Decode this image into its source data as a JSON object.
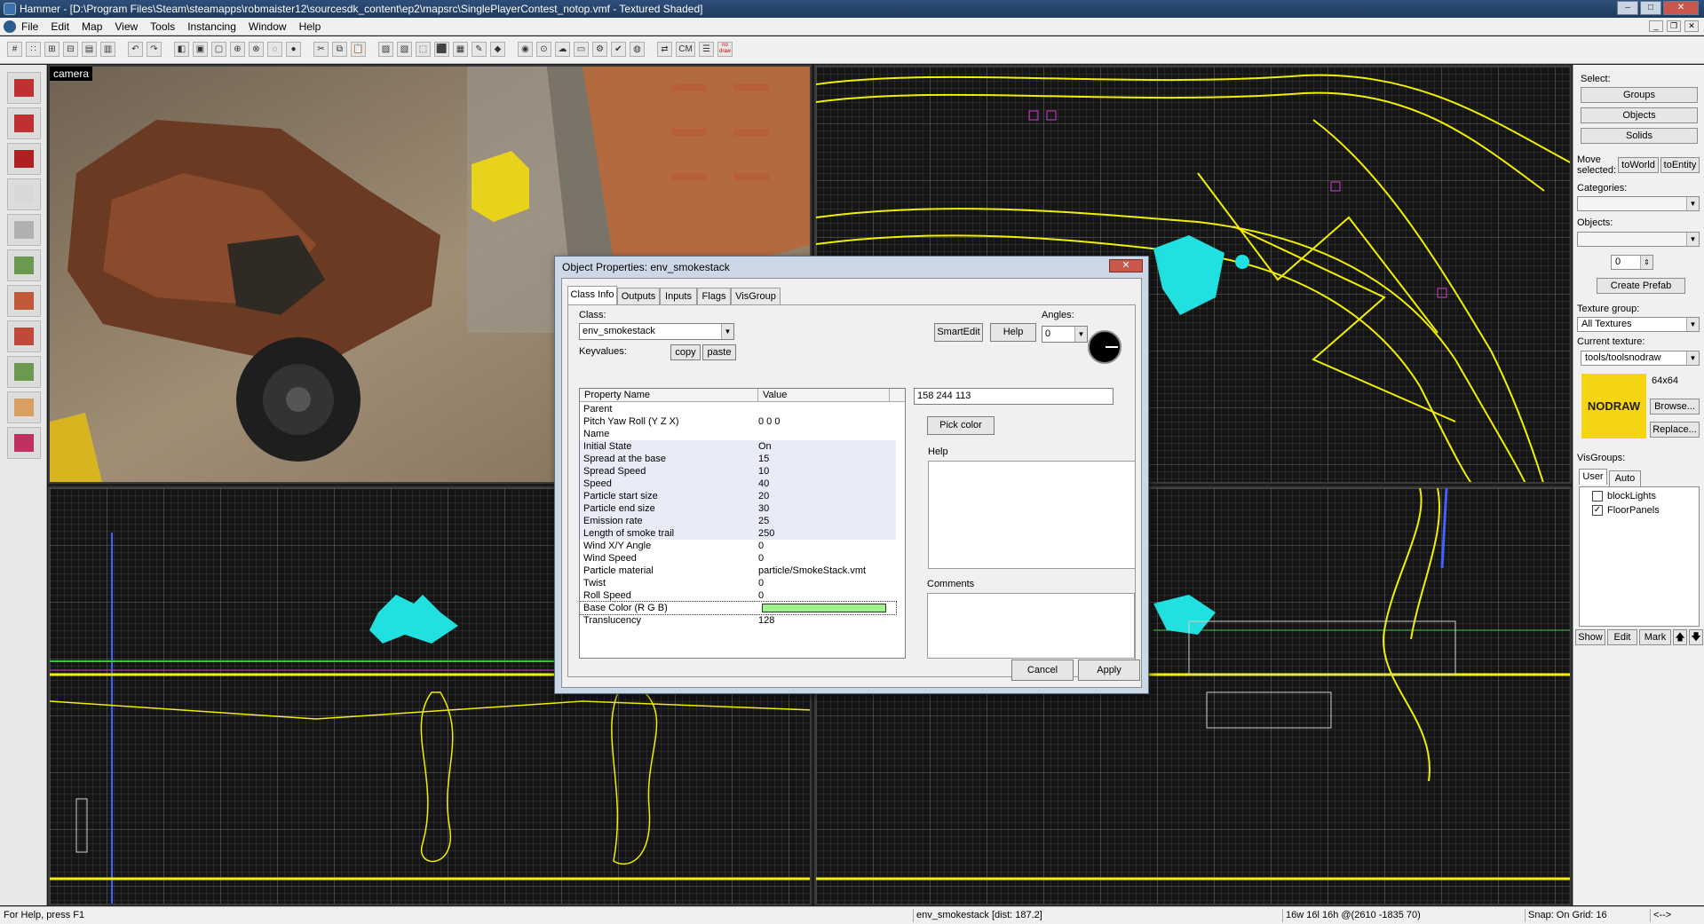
{
  "window": {
    "title": "Hammer - [D:\\Program Files\\Steam\\steamapps\\robmaister12\\sourcesdk_content\\ep2\\mapsrc\\SinglePlayerContest_notop.vmf - Textured Shaded]",
    "minimize": "–",
    "maximize": "□",
    "close": "✕"
  },
  "menu": [
    "File",
    "Edit",
    "Map",
    "View",
    "Tools",
    "Instancing",
    "Window",
    "Help"
  ],
  "toolbar": {
    "icons": [
      "grid-toggle-icon",
      "grid-dots-icon",
      "grid-larger-icon",
      "grid-smaller-icon",
      "load-window-state-icon",
      "save-window-state-icon",
      "undo-icon",
      "redo-icon",
      "carve-icon",
      "group-icon",
      "ungroup-icon",
      "tie-to-entity-icon",
      "move-to-world-icon",
      "hide-icon",
      "show-icon",
      "cut-icon",
      "copy-icon",
      "paste-icon",
      "texture-lock-icon",
      "texture-scale-lock-icon",
      "selection-box-icon",
      "select-icon",
      "hollow-icon",
      "clip-icon",
      "vertex-icon",
      "toggle-models-icon",
      "toggle-helpers-icon",
      "toggle-fog-icon",
      "toggle-cordon-icon",
      "compile-icon",
      "check-map-icon",
      "cubemap-icon",
      "flip-icon",
      "cm-icon",
      "entity-report-icon",
      "no-draw-icon"
    ],
    "cm_label": "CM",
    "nodraw_label": "no draw"
  },
  "palette_tools": [
    "selection-tool-icon",
    "magnify-tool-icon",
    "camera-tool-icon",
    "entity-tool-icon",
    "block-tool-icon",
    "toggle-texture-app-icon",
    "apply-current-texture-icon",
    "apply-decal-icon",
    "apply-overlay-icon",
    "clipping-tool-icon",
    "vertex-tool-icon"
  ],
  "viewports": {
    "camera_label": "camera"
  },
  "right_panel": {
    "select_label": "Select:",
    "groups": "Groups",
    "objects_btn": "Objects",
    "solids": "Solids",
    "move_selected": "Move selected:",
    "to_world": "toWorld",
    "to_entity": "toEntity",
    "categories_label": "Categories:",
    "categories_value": "",
    "objects_label": "Objects:",
    "objects_value": "",
    "spin_value": "0",
    "create_prefab": "Create Prefab",
    "texture_group_label": "Texture group:",
    "texture_group_value": "All Textures",
    "current_texture_label": "Current texture:",
    "current_texture_value": "tools/toolsnodraw",
    "texture_size": "64x64",
    "texture_swatch_text": "NODRAW",
    "texture_swatch_color": "#f5d315",
    "browse": "Browse...",
    "replace": "Replace...",
    "visgroups_label": "VisGroups:",
    "tab_user": "User",
    "tab_auto": "Auto",
    "visgroups": [
      {
        "name": "blockLights",
        "checked": ""
      },
      {
        "name": "FloorPanels",
        "checked": "✓"
      }
    ],
    "show": "Show",
    "edit": "Edit",
    "mark": "Mark",
    "up": "🡅",
    "down": "🡇"
  },
  "dialog": {
    "title": "Object Properties: env_smokestack",
    "close": "✕",
    "tabs": [
      "Class Info",
      "Outputs",
      "Inputs",
      "Flags",
      "VisGroup"
    ],
    "class_label": "Class:",
    "class_value": "env_smokestack",
    "smartedit": "SmartEdit",
    "help_btn": "Help",
    "angles_label": "Angles:",
    "angles_value": "0",
    "keyvalues_label": "Keyvalues:",
    "copy": "copy",
    "paste": "paste",
    "col_property": "Property Name",
    "col_value": "Value",
    "rows": [
      {
        "k": "Parent",
        "v": ""
      },
      {
        "k": "Pitch Yaw Roll (Y Z X)",
        "v": "0 0 0"
      },
      {
        "k": "Name",
        "v": ""
      },
      {
        "k": "Initial State",
        "v": "On"
      },
      {
        "k": "Spread at the base",
        "v": "15"
      },
      {
        "k": "Spread Speed",
        "v": "10"
      },
      {
        "k": "Speed",
        "v": "40"
      },
      {
        "k": "Particle start size",
        "v": "20"
      },
      {
        "k": "Particle end size",
        "v": "30"
      },
      {
        "k": "Emission rate",
        "v": "25"
      },
      {
        "k": "Length of smoke trail",
        "v": "250"
      },
      {
        "k": "Wind X/Y Angle",
        "v": "0"
      },
      {
        "k": "Wind Speed",
        "v": "0"
      },
      {
        "k": "Particle material",
        "v": "particle/SmokeStack.vmt"
      },
      {
        "k": "Twist",
        "v": "0"
      },
      {
        "k": "Roll Speed",
        "v": "0"
      },
      {
        "k": "Base Color (R G B)",
        "v": ""
      },
      {
        "k": "Translucency",
        "v": "128"
      }
    ],
    "base_color_swatch": "#9ef48a",
    "value_field": "158 244 113",
    "pick_color": "Pick color",
    "help_label": "Help",
    "comments_label": "Comments",
    "cancel": "Cancel",
    "apply": "Apply"
  },
  "status": {
    "help": "For Help, press F1",
    "selection": "env_smokestack  [dist: 187.2]",
    "coords": "16w 16l 16h @(2610 -1835 70)",
    "snap": "Snap: On Grid: 16",
    "arrows": "<-->"
  },
  "colors": {
    "wire_yellow": "#f0f000",
    "wire_cyan": "#20e0e0",
    "wire_magenta": "#d040d0",
    "wire_green": "#40c040",
    "wire_blue": "#4060ff"
  }
}
